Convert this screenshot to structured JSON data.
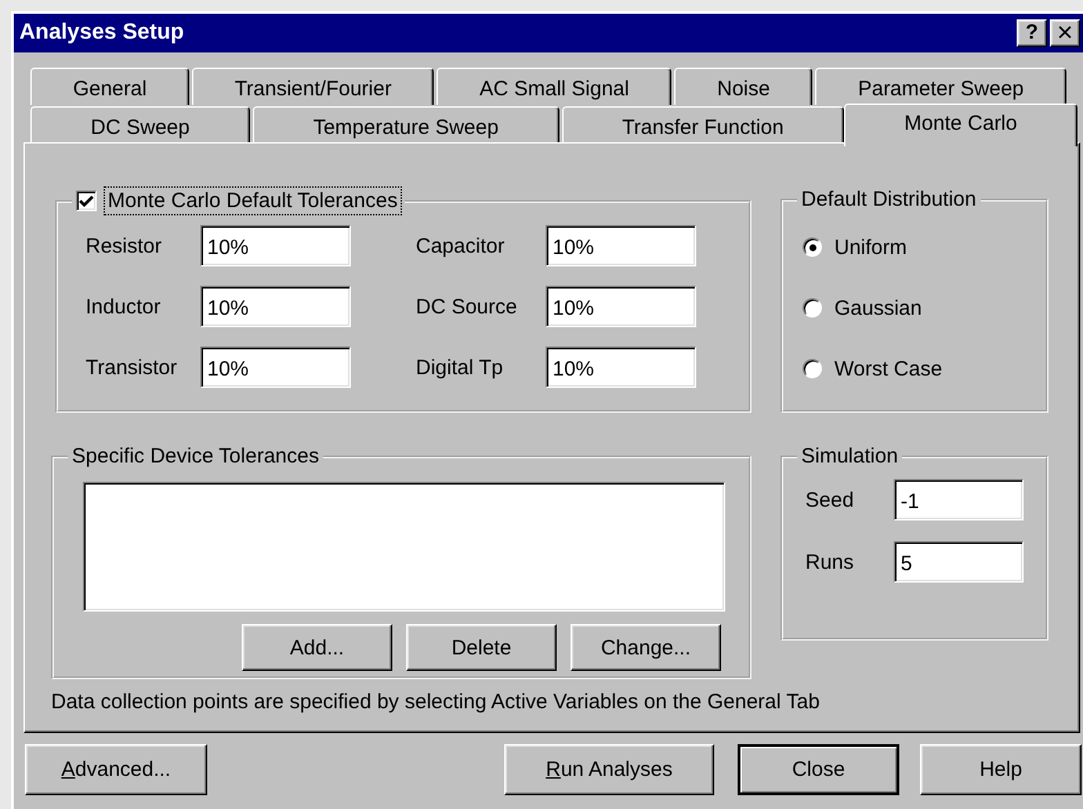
{
  "window": {
    "title": "Analyses Setup",
    "title_buttons": [
      {
        "kind": "help",
        "label": "?"
      },
      {
        "kind": "close",
        "label": "×"
      }
    ]
  },
  "tabs": [
    [
      {
        "label": "General",
        "selected": false
      },
      {
        "label": "Transient/Fourier",
        "selected": false
      },
      {
        "label": "AC Small Signal",
        "selected": false
      },
      {
        "label": "Noise",
        "selected": false
      },
      {
        "label": "Parameter Sweep",
        "selected": false
      }
    ],
    [
      {
        "label": "DC Sweep",
        "selected": false
      },
      {
        "label": "Temperature Sweep",
        "selected": false
      },
      {
        "label": "Transfer Function",
        "selected": false
      },
      {
        "label": "Monte Carlo",
        "selected": true
      }
    ]
  ],
  "default_tolerances": {
    "label": "Monte Carlo Default Tolerances",
    "checked": true,
    "focused": true,
    "fields": [
      {
        "label": "Resistor",
        "value": "10%"
      },
      {
        "label": "Capacitor",
        "value": "10%"
      },
      {
        "label": "Inductor",
        "value": "10%"
      },
      {
        "label": "DC Source",
        "value": "10%"
      },
      {
        "label": "Transistor",
        "value": "10%"
      },
      {
        "label": "Digital Tp",
        "value": "10%"
      }
    ]
  },
  "default_distribution": {
    "title": "Default Distribution",
    "options": [
      {
        "label": "Uniform",
        "selected": true
      },
      {
        "label": "Gaussian",
        "selected": false
      },
      {
        "label": "Worst Case",
        "selected": false
      }
    ]
  },
  "specific_device_tolerances": {
    "title": "Specific Device Tolerances",
    "buttons": [
      "Add...",
      "Delete",
      "Change..."
    ]
  },
  "simulation": {
    "title": "Simulation",
    "fields": [
      {
        "label": "Seed",
        "value": "-1"
      },
      {
        "label": "Runs",
        "value": "5"
      }
    ]
  },
  "note": "Data collection points are specified by selecting Active Variables on the General Tab",
  "buttons": [
    {
      "label_parts": [
        {
          "text": "A",
          "underline": true
        },
        {
          "text": "dvanced...",
          "underline": false
        }
      ],
      "default": false
    },
    {
      "label_parts": [
        {
          "text": "R",
          "underline": true
        },
        {
          "text": "un Analyses",
          "underline": false
        }
      ],
      "default": false
    },
    {
      "label_parts": [
        {
          "text": "Close",
          "underline": false
        }
      ],
      "default": true
    },
    {
      "label_parts": [
        {
          "text": "Help",
          "underline": false
        }
      ],
      "default": false
    }
  ]
}
